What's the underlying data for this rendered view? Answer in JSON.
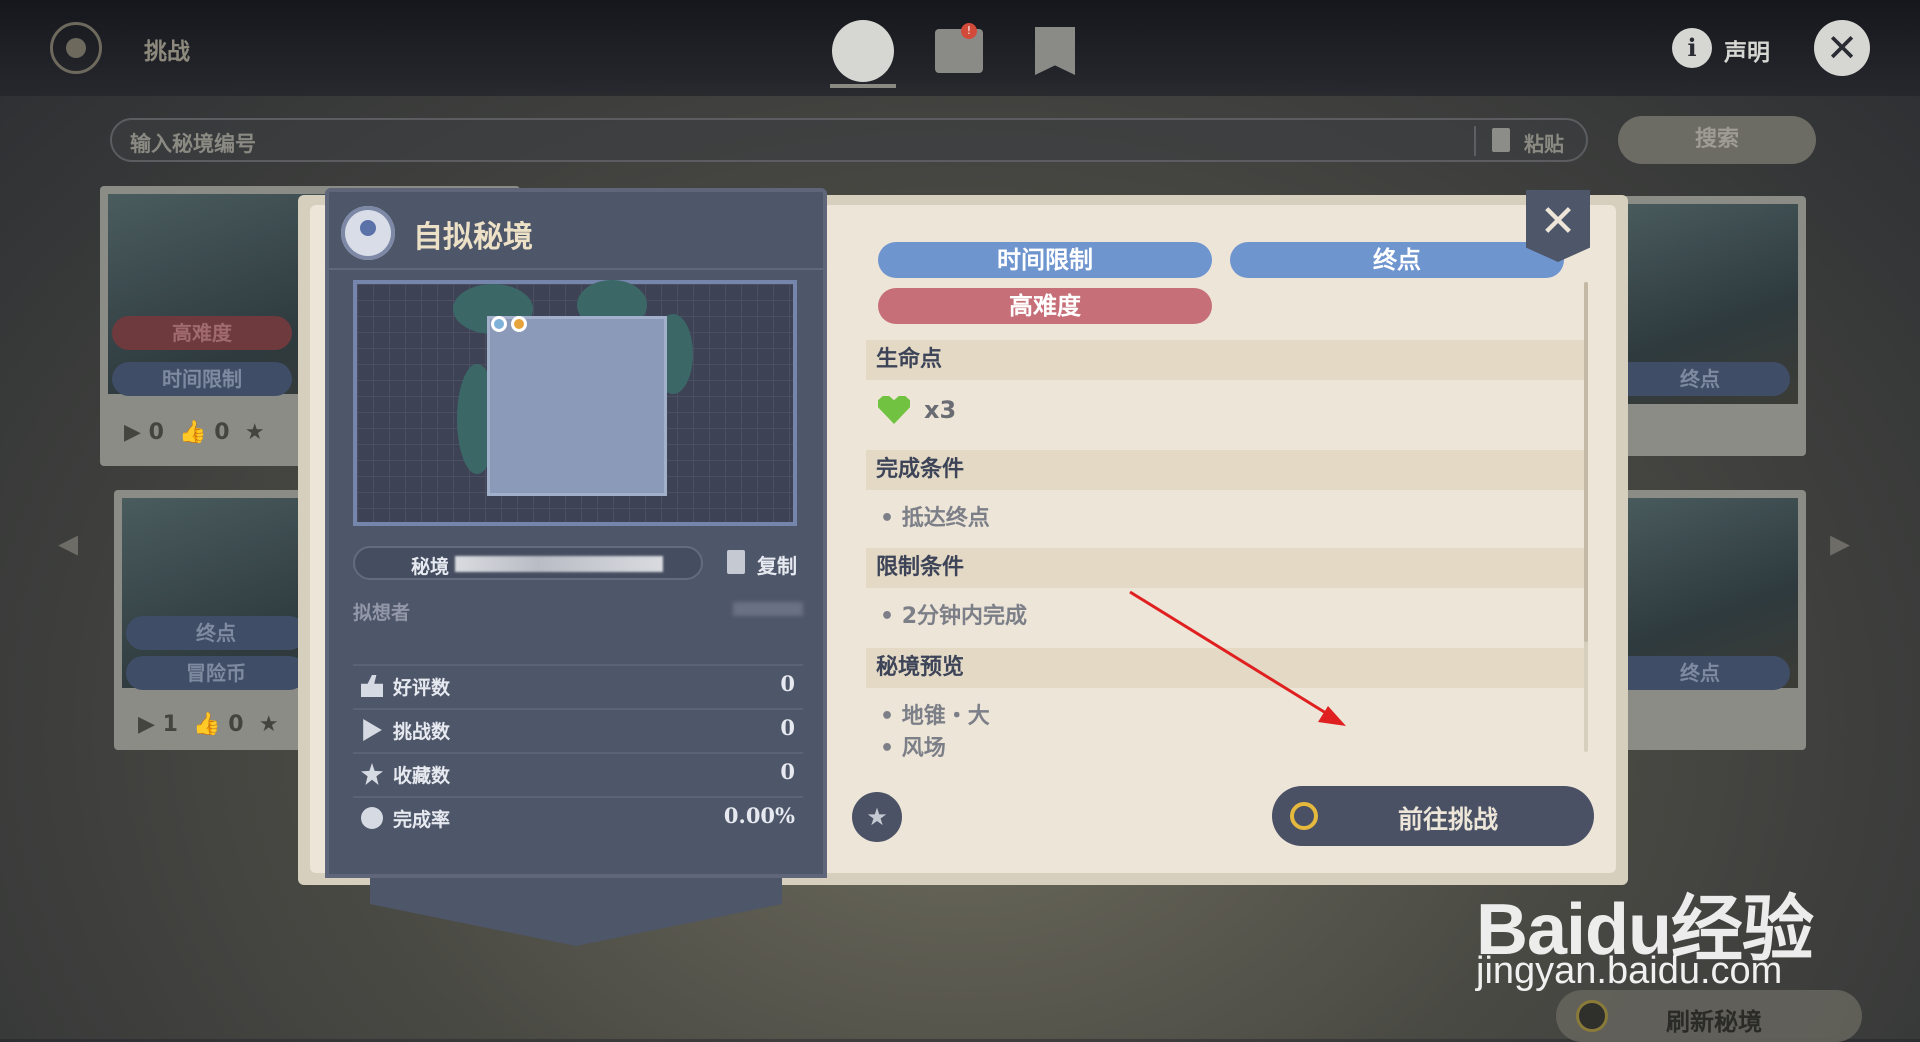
{
  "topbar": {
    "title": "挑战",
    "info_label": "声明",
    "notice_badge": "!"
  },
  "search": {
    "placeholder": "输入秘境编号",
    "paste_label": "粘贴",
    "button_label": "搜索"
  },
  "background_cards": [
    {
      "tags": [
        "高难度",
        "时间限制"
      ],
      "plays": "0",
      "likes": "0"
    },
    {
      "tags": [
        "终点",
        "冒险币"
      ],
      "plays": "1",
      "likes": "0"
    },
    {
      "tags": [
        "终点"
      ]
    },
    {
      "tags": [
        "终点"
      ]
    }
  ],
  "panel": {
    "title": "自拟秘境",
    "id_label": "秘境",
    "copy_label": "复制",
    "author_label": "拟想者",
    "stats": [
      {
        "label": "好评数",
        "value": "0",
        "icon": "thumbs-up-icon"
      },
      {
        "label": "挑战数",
        "value": "0",
        "icon": "play-icon"
      },
      {
        "label": "收藏数",
        "value": "0",
        "icon": "star-icon"
      },
      {
        "label": "完成率",
        "value": "0.00%",
        "icon": "pie-icon"
      }
    ]
  },
  "details": {
    "tags": {
      "time_limit": "时间限制",
      "endpoint": "终点",
      "hard": "高难度"
    },
    "lives": {
      "heading": "生命点",
      "value": "x3"
    },
    "completion": {
      "heading": "完成条件",
      "items": [
        "• 抵达终点"
      ]
    },
    "restriction": {
      "heading": "限制条件",
      "items": [
        "• 2分钟内完成"
      ]
    },
    "preview": {
      "heading": "秘境预览",
      "items": [
        "• 地锥・大",
        "• 风场"
      ]
    },
    "go_button": "前往挑战"
  },
  "refresh_label": "刷新秘境",
  "watermark": {
    "logo": "Baidu经验",
    "url": "jingyan.baidu.com"
  },
  "colors": {
    "tag_blue": "#6f95cf",
    "tag_red": "#c76f78",
    "panel": "#4e5669",
    "parchment": "#ece5d8",
    "heart": "#71c240",
    "arrow": "#e02020"
  }
}
